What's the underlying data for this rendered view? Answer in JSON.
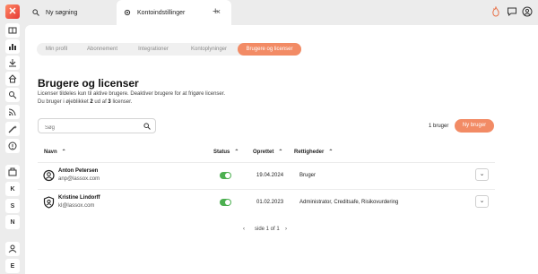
{
  "tabs": {
    "search_label": "Ny søgning",
    "active_label": "Kontoindstillinger",
    "close_glyph": "×",
    "add_glyph": "+"
  },
  "topbar_icons": [
    "fire-icon",
    "chat-icon",
    "profile-icon"
  ],
  "sidebar": {
    "logo": "✕",
    "icons": [
      "book-icon",
      "chart-icon",
      "download-icon",
      "home-icon",
      "search-list-icon",
      "rss-icon",
      "magic-wand-icon",
      "info-icon",
      "building-icon"
    ],
    "letters": [
      "K",
      "S",
      "N",
      "E"
    ],
    "bottom_icon": "people-icon"
  },
  "subtabs": [
    "Min profil",
    "Abonnement",
    "Integrationer",
    "Kontoplyninger",
    "Brugere og licenser"
  ],
  "page": {
    "title": "Brugere og licenser",
    "desc1": "Licenser tildeles kun til aktive brugere. Deaktiver brugere for at frigøre licenser.",
    "desc2_prefix": "Du bruger i øjeblikket",
    "desc2_used": "2",
    "desc2_mid": "ud af",
    "desc2_total": "3",
    "desc2_suffix": "licenser."
  },
  "search": {
    "placeholder": "Søg"
  },
  "user_count": "1 bruger",
  "new_user_label": "Ny bruger",
  "columns": {
    "name": "Navn",
    "status": "Status",
    "created": "Oprettet",
    "rights": "Rettigheder"
  },
  "users": [
    {
      "name": "Anton Petersen",
      "email": "anp@lassox.com",
      "active": true,
      "created": "19.04.2024",
      "rights": "Bruger",
      "avatar": "user-circle-icon"
    },
    {
      "name": "Kristine Lindorff",
      "email": "kl@lassox.com",
      "active": true,
      "created": "01.02.2023",
      "rights": "Administrator, Creditsafe, Risikovurdering",
      "avatar": "admin-shield-icon"
    }
  ],
  "pagination": {
    "label": "side 1 of 1",
    "prev": "‹",
    "next": "›"
  },
  "colors": {
    "accent": "#f28b65",
    "toggle_on": "#4caf50"
  }
}
